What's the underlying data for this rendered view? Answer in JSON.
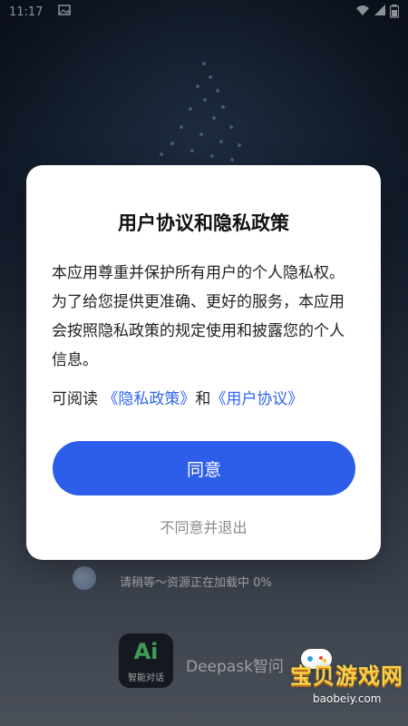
{
  "status_bar": {
    "time": "11:17"
  },
  "dialog": {
    "title": "用户协议和隐私政策",
    "body": "本应用尊重并保护所有用户的个人隐私权。为了给您提供更准确、更好的服务，本应用会按照隐私政策的规定使用和披露您的个人信息。",
    "links_prefix": "可阅读",
    "privacy_link": "《隐私政策》",
    "links_and": "和",
    "agreement_link": "《用户协议》",
    "agree_label": "同意",
    "disagree_label": "不同意并退出"
  },
  "loading": {
    "text": "请稍等～资源正在加载中 0%",
    "progress_percent": 0
  },
  "app": {
    "logo_main": "Ai",
    "logo_caption": "智能对话",
    "name": "Deepask智问"
  },
  "watermark": {
    "text": "宝贝游戏网",
    "sub": "baobeiy.com"
  },
  "colors": {
    "accent": "#2d5eea",
    "link": "#2f64f1"
  },
  "icons": [
    "image-icon",
    "wifi-icon",
    "signal-icon",
    "battery-icon",
    "gamepad-icon"
  ]
}
